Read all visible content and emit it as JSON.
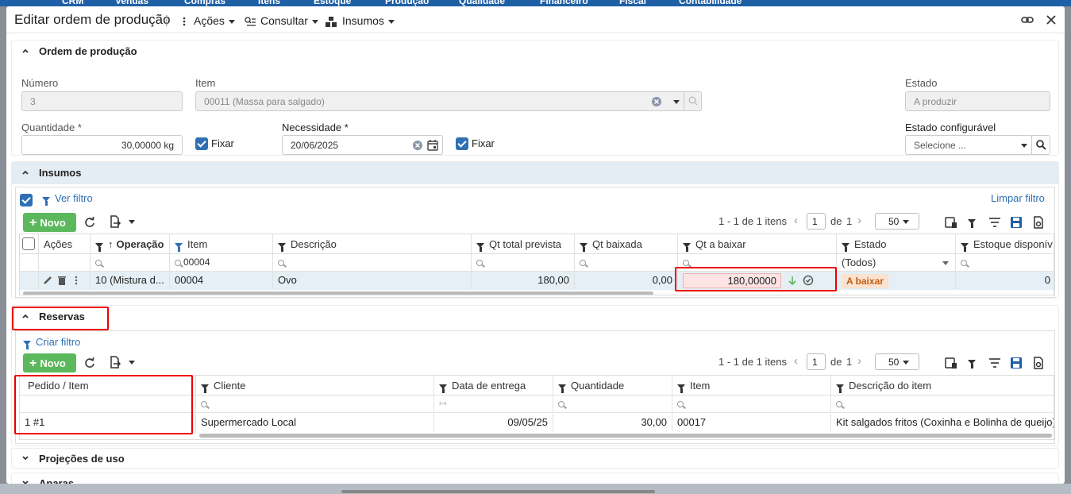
{
  "topnav": [
    "CRM",
    "Vendas",
    "Compras",
    "Itens",
    "Estoque",
    "Produção",
    "Qualidade",
    "Financeiro",
    "Fiscal",
    "Contabilidade"
  ],
  "modal": {
    "title": "Editar ordem de produção",
    "divider": "|",
    "menus": {
      "acoes": "Ações",
      "consultar": "Consultar",
      "insumos": "Insumos"
    }
  },
  "ordem": {
    "section_title": "Ordem de produção",
    "numero_label": "Número",
    "numero_value": "3",
    "item_label": "Item",
    "item_value": "00011 (Massa para salgado)",
    "estado_label": "Estado",
    "estado_value": "A produzir",
    "quantidade_label": "Quantidade *",
    "quantidade_value": "30,00000 kg",
    "fixar1_label": "Fixar",
    "necessidade_label": "Necessidade *",
    "necessidade_value": "20/06/2025",
    "fixar2_label": "Fixar",
    "estado_config_label": "Estado configurável",
    "estado_config_placeholder": "Selecione ..."
  },
  "insumos": {
    "section_title": "Insumos",
    "ver_filtro": "Ver filtro",
    "limpar_filtro": "Limpar filtro",
    "novo": "Novo",
    "pager": {
      "range": "1 - 1 de 1 itens",
      "page": "1",
      "de": "de",
      "total_pages": "1",
      "page_size": "50"
    },
    "columns": {
      "acoes": "Ações",
      "operacao": "Operação",
      "item": "Item",
      "descricao": "Descrição",
      "qt_total": "Qt total prevista",
      "qt_baixada": "Qt baixada",
      "qt_a_baixar": "Qt a baixar",
      "estado": "Estado",
      "estoque": "Estoque disponív"
    },
    "filters": {
      "item": "00004",
      "estado": "(Todos)"
    },
    "row": {
      "operacao": "10 (Mistura d...",
      "item": "00004",
      "descricao": "Ovo",
      "qt_total": "180,00",
      "qt_baixada": "0,00",
      "qt_a_baixar": "180,00000",
      "estado": "A baixar",
      "estoque": "0"
    }
  },
  "reservas": {
    "section_title": "Reservas",
    "criar_filtro": "Criar filtro",
    "novo": "Novo",
    "pager": {
      "range": "1 - 1 de 1 itens",
      "page": "1",
      "de": "de",
      "total_pages": "1",
      "page_size": "50"
    },
    "columns": {
      "pedido": "Pedido / Item",
      "cliente": "Cliente",
      "data": "Data de entrega",
      "quantidade": "Quantidade",
      "item": "Item",
      "descricao": "Descrição do item"
    },
    "row": {
      "pedido": "1 #1",
      "cliente": "Supermercado Local",
      "data": "09/05/25",
      "quantidade": "30,00",
      "item": "00017",
      "descricao": "Kit salgados fritos (Coxinha e Bolinha de queijo)"
    }
  },
  "projecoes": {
    "section_title": "Projeções de uso"
  },
  "aparas": {
    "section_title": "Aparas"
  },
  "colors": {
    "accent": "#2f6fb3",
    "green": "#5cb85c",
    "highlight": "#e00000",
    "badge_bg": "#fbe3cf",
    "badge_fg": "#c05e14"
  }
}
